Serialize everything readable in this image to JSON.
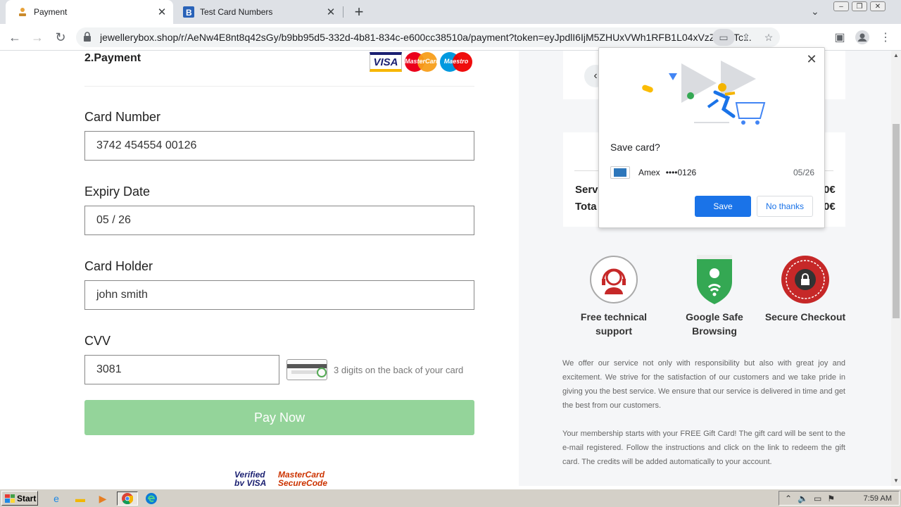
{
  "browser": {
    "tabs": [
      {
        "title": "Payment",
        "favicon": "jewelry-icon"
      },
      {
        "title": "Test Card Numbers",
        "favicon": "b-icon"
      }
    ],
    "url": "jewellerybox.shop/r/AeNw4E8nt8q42sGy/b9bb95d5-332d-4b81-834c-e600cc38510a/payment?token=eyJpdlI6IjM5ZHUxVWh1RFB1L04xVzZjc0pTc..."
  },
  "payment": {
    "section_title": "2.Payment",
    "card_logos": [
      "VISA",
      "MasterCard",
      "Maestro"
    ],
    "card_number_label": "Card Number",
    "card_number_value": "3742 454554 00126",
    "expiry_label": "Expiry Date",
    "expiry_value": "05 / 26",
    "holder_label": "Card Holder",
    "holder_value": "john smith",
    "cvv_label": "CVV",
    "cvv_value": "3081",
    "cvv_hint": "3 digits on the back of your card",
    "pay_button": "Pay Now",
    "verified_visa": "Verified by VISA",
    "mastercard_secure": "MasterCard SecureCode"
  },
  "summary": {
    "service_label": "Serv",
    "total_label": "Tota",
    "service_amount": "0€",
    "total_amount": "0€"
  },
  "badges": [
    {
      "label": "Free technical support",
      "icon": "headset-icon"
    },
    {
      "label": "Google Safe Browsing",
      "icon": "shield-icon"
    },
    {
      "label": "Secure Checkout",
      "icon": "secure-checkout-seal-icon"
    }
  ],
  "paragraphs": [
    "We offer our service not only with responsibility but also with great joy and excitement. We strive for the satisfaction of our customers and we take pride in giving you the best service. We ensure that our service is delivered in time and get the best from our customers.",
    "Your membership starts with your FREE Gift Card! The gift card will be sent to the e-mail registered. Follow the instructions and click on the link to redeem the gift card. The credits will be added automatically to your account."
  ],
  "popup": {
    "question": "Save card?",
    "card_brand": "Amex",
    "card_masked": "••••0126",
    "card_expiry": "05/26",
    "save_label": "Save",
    "no_thanks_label": "No thanks"
  },
  "taskbar": {
    "start_label": "Start",
    "clock": "7:59 AM"
  },
  "colors": {
    "pay_button": "#94d49a",
    "save_button": "#1a73e8"
  }
}
